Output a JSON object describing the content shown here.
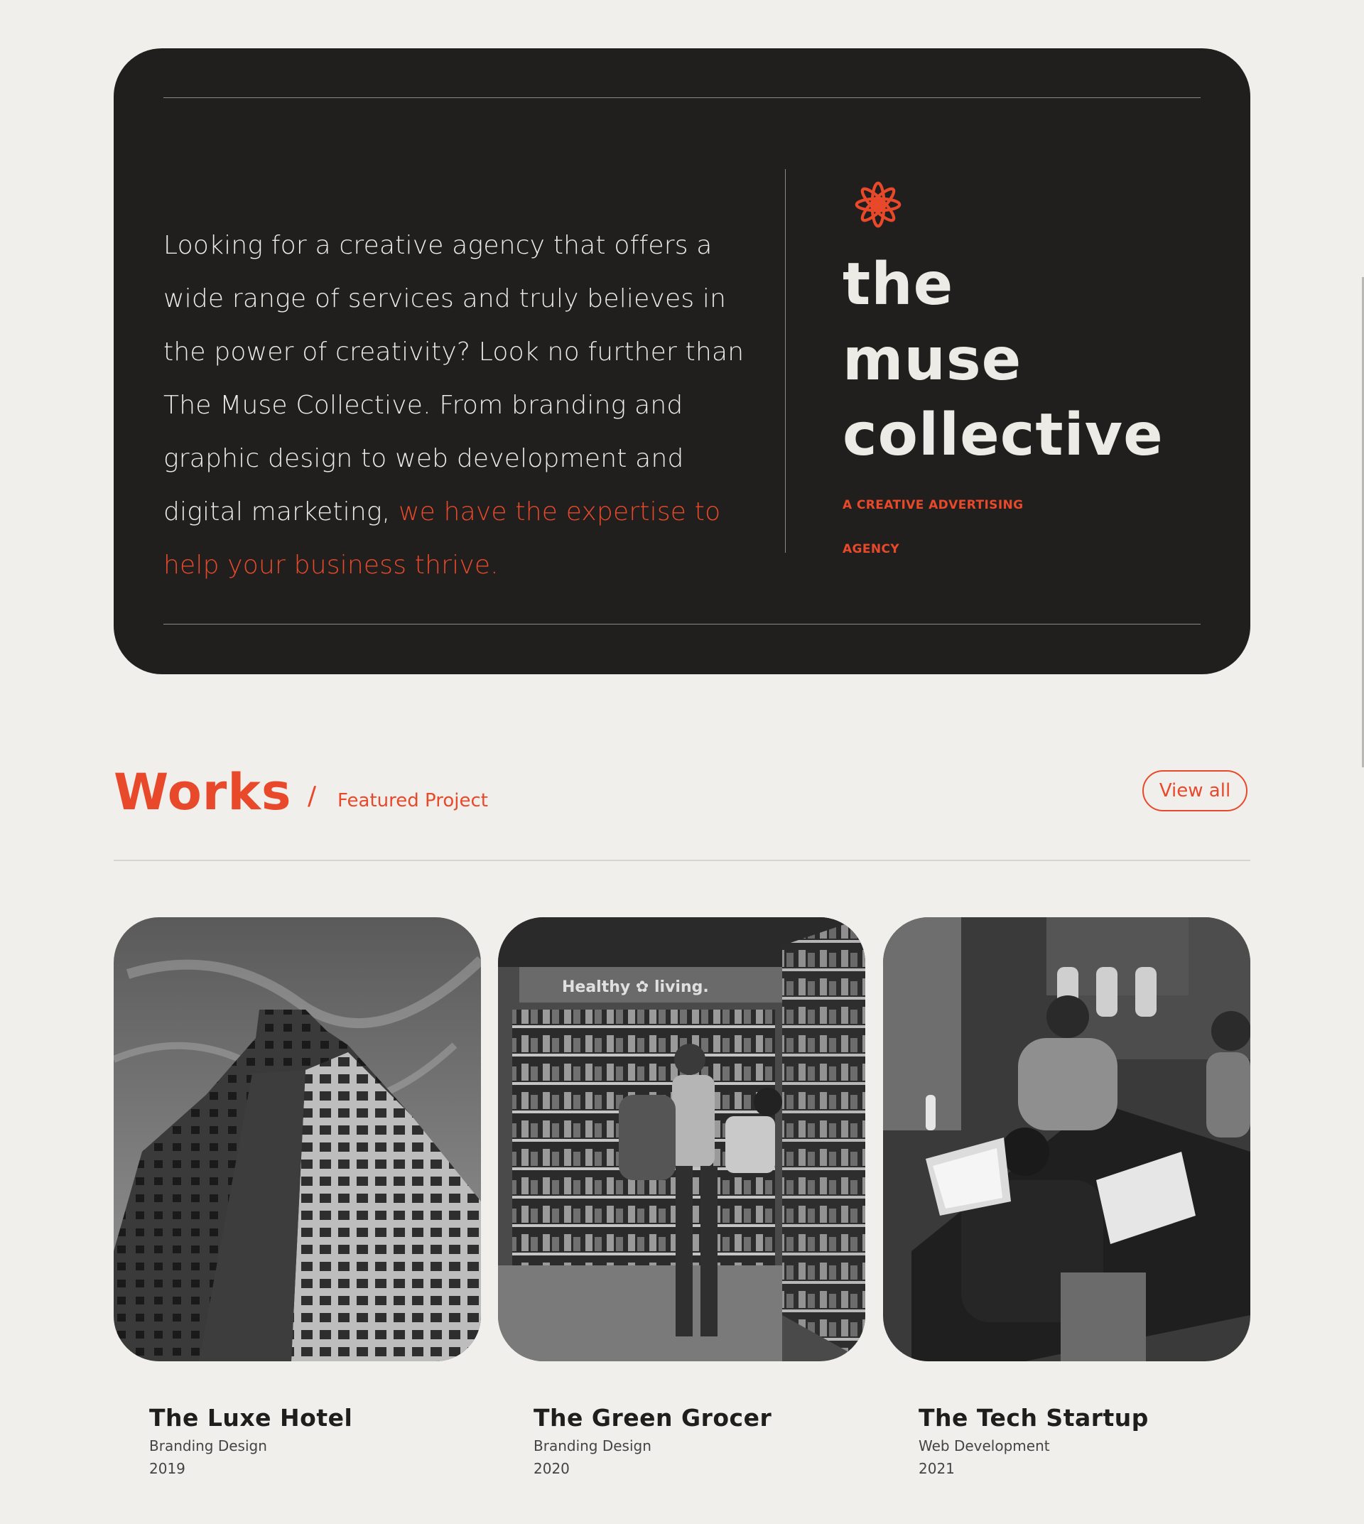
{
  "hero": {
    "text_main": "Looking for a creative agency that offers a wide range of services and truly believes in the power of creativity? Look no further than The Muse Collective. From branding and graphic design to web development and digital marketing,",
    "text_accent": "we have the expertise to help your business thrive.",
    "brand_line1": "the",
    "brand_line2": "muse",
    "brand_line3": "collective",
    "tagline": "A CREATIVE ADVERTISING AGENCY"
  },
  "works": {
    "title": "Works",
    "separator": "/",
    "subtitle": "Featured Project",
    "view_all": "View all",
    "projects": [
      {
        "title": "The Luxe Hotel",
        "category": "Branding Design",
        "year": "2019",
        "image": "building-photo"
      },
      {
        "title": "The Green Grocer",
        "category": "Branding Design",
        "year": "2020",
        "image": "grocery-store-photo"
      },
      {
        "title": "The Tech Startup",
        "category": "Web Development",
        "year": "2021",
        "image": "team-working-photo"
      }
    ]
  },
  "colors": {
    "accent": "#e8492a",
    "dark": "#201f1e",
    "background": "#f0efeb",
    "light_text": "#ecebe6"
  }
}
